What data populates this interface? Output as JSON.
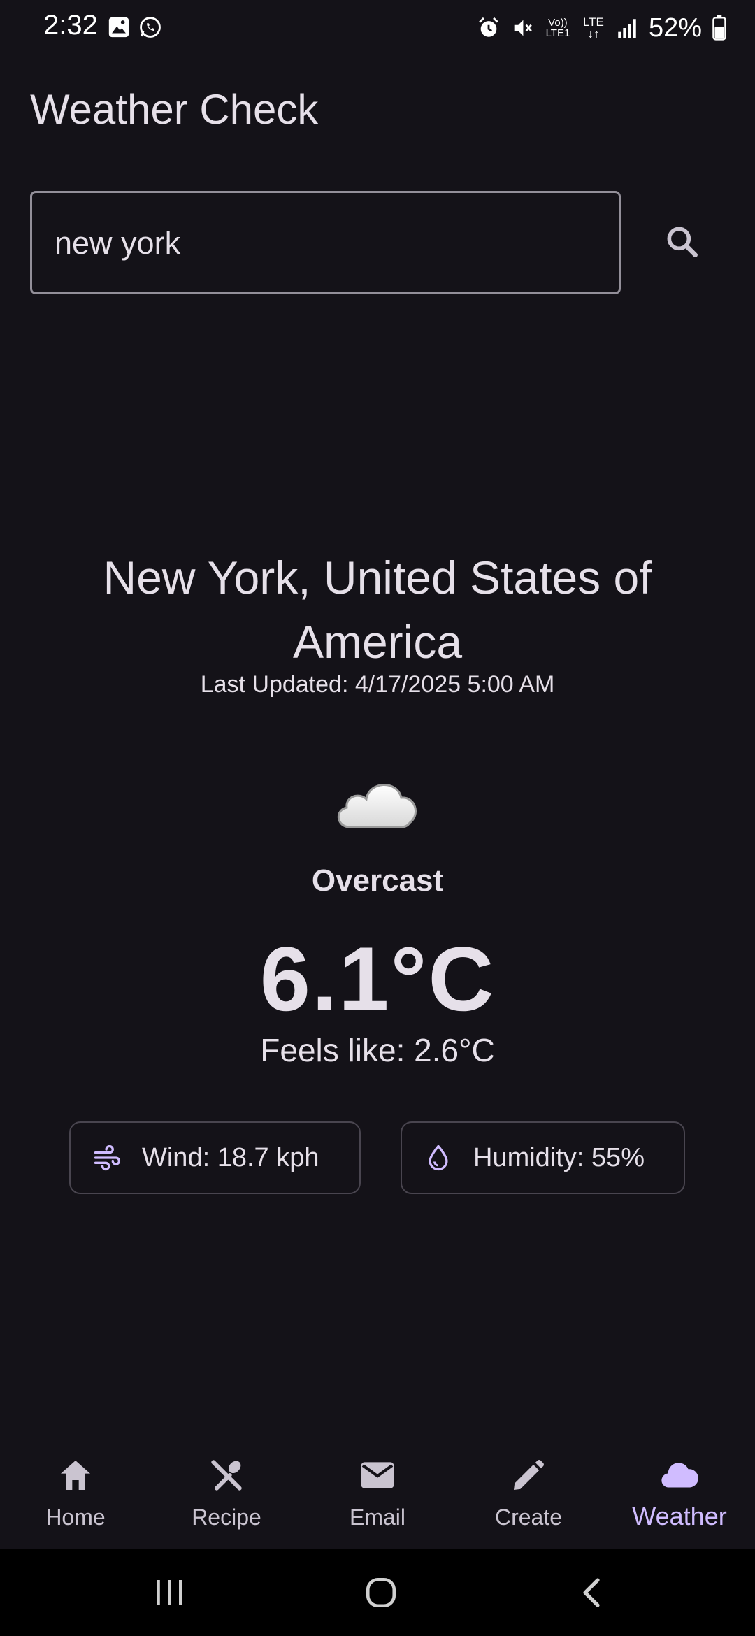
{
  "status_bar": {
    "time": "2:32",
    "battery": "52%",
    "left_icons": [
      "image-icon",
      "whatsapp-icon"
    ],
    "right_icons": [
      "alarm-icon",
      "mute-icon",
      "volte-icon",
      "lte-icon",
      "signal-icon",
      "battery-icon"
    ],
    "volte_label": "Vo)) LTE1",
    "lte_label": "LTE"
  },
  "app": {
    "title": "Weather Check"
  },
  "search": {
    "value": "new york",
    "placeholder": ""
  },
  "weather": {
    "location": "New York, United States of America",
    "last_updated": "Last Updated: 4/17/2025 5:00 AM",
    "icon": "cloud-icon",
    "condition": "Overcast",
    "temperature": "6.1°C",
    "feels_like": "Feels like: 2.6°C",
    "wind": "Wind: 18.7 kph",
    "humidity": "Humidity: 55%"
  },
  "bottom_nav": {
    "items": [
      {
        "label": "Home",
        "icon": "home-icon"
      },
      {
        "label": "Recipe",
        "icon": "utensils-icon"
      },
      {
        "label": "Email",
        "icon": "mail-icon"
      },
      {
        "label": "Create",
        "icon": "pencil-icon"
      },
      {
        "label": "Weather",
        "icon": "cloud-icon",
        "active": true
      }
    ]
  },
  "colors": {
    "background": "#141218",
    "text": "#e6e0e9",
    "accent": "#d0bcff",
    "outline": "#938f99"
  }
}
